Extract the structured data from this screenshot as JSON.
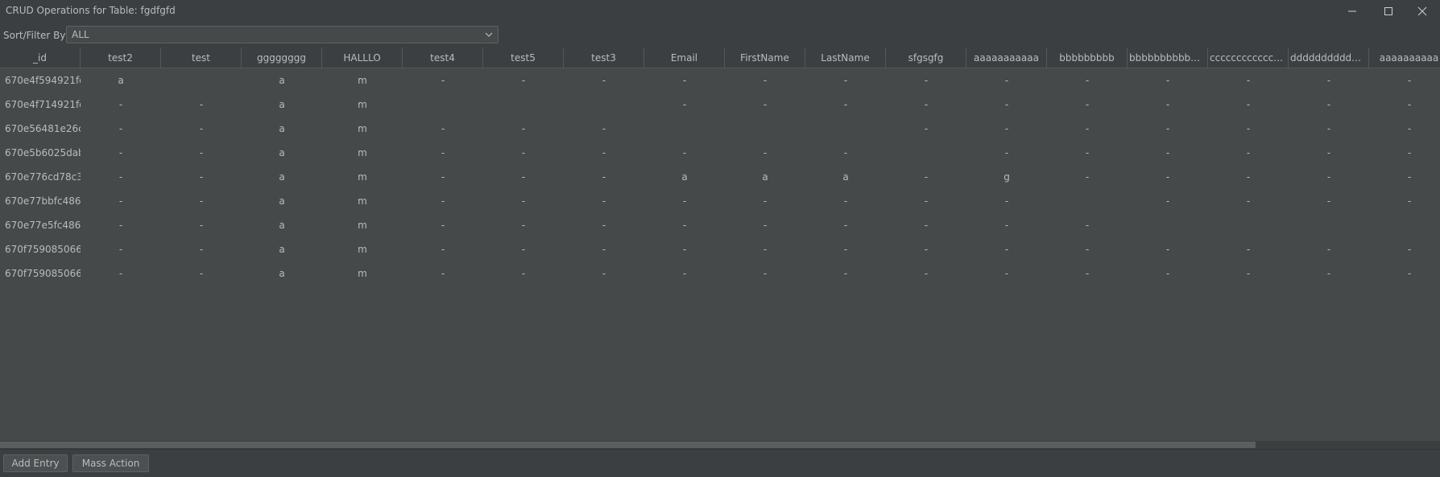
{
  "window": {
    "title": "CRUD Operations for Table: fgdfgfd",
    "icons": [
      "minimize-icon",
      "maximize-icon",
      "close-icon"
    ]
  },
  "filter": {
    "label": "Sort/Filter By:",
    "value": "ALL"
  },
  "table": {
    "columns": [
      "_id",
      "test2",
      "test",
      "gggggggg",
      "HALLLO",
      "test4",
      "test5",
      "test3",
      "Email",
      "FirstName",
      "LastName",
      "sfgsgfg",
      "aaaaaaaaaaa",
      "bbbbbbbbb",
      "bbbbbbbbbbbbb...",
      "cccccccccccccccc",
      "dddddddddddddd",
      "aaaaaaaaaa"
    ],
    "rows": [
      [
        "670e4f594921fe...",
        "a",
        "",
        "a",
        "m",
        "-",
        "-",
        "-",
        "-",
        "-",
        "-",
        "-",
        "-",
        "-",
        "-",
        "-",
        "-",
        "-"
      ],
      [
        "670e4f714921fe...",
        "-",
        "-",
        "a",
        "m",
        "",
        "",
        "",
        "-",
        "-",
        "-",
        "-",
        "-",
        "-",
        "-",
        "-",
        "-",
        "-"
      ],
      [
        "670e56481e26c1...",
        "-",
        "-",
        "a",
        "m",
        "-",
        "-",
        "-",
        "",
        "",
        "",
        "-",
        "-",
        "-",
        "-",
        "-",
        "-",
        "-"
      ],
      [
        "670e5b6025dab...",
        "-",
        "-",
        "a",
        "m",
        "-",
        "-",
        "-",
        "-",
        "-",
        "-",
        "",
        "-",
        "-",
        "-",
        "-",
        "-",
        "-"
      ],
      [
        "670e776cd78c3c...",
        "-",
        "-",
        "a",
        "m",
        "-",
        "-",
        "-",
        "a",
        "a",
        "a",
        "-",
        "g",
        "-",
        "-",
        "-",
        "-",
        "-"
      ],
      [
        "670e77bbfc4867...",
        "-",
        "-",
        "a",
        "m",
        "-",
        "-",
        "-",
        "-",
        "-",
        "-",
        "-",
        "-",
        "",
        "-",
        "-",
        "-",
        "-"
      ],
      [
        "670e77e5fc4867...",
        "-",
        "-",
        "a",
        "m",
        "-",
        "-",
        "-",
        "-",
        "-",
        "-",
        "-",
        "-",
        "-",
        "",
        "",
        "",
        ""
      ],
      [
        "670f759085066e...",
        "-",
        "-",
        "a",
        "m",
        "-",
        "-",
        "-",
        "-",
        "-",
        "-",
        "-",
        "-",
        "-",
        "-",
        "-",
        "-",
        "-"
      ],
      [
        "670f759085066e...",
        "-",
        "-",
        "a",
        "m",
        "-",
        "-",
        "-",
        "-",
        "-",
        "-",
        "-",
        "-",
        "-",
        "-",
        "-",
        "-",
        "-"
      ]
    ]
  },
  "buttons": {
    "add_entry": "Add Entry",
    "mass_action": "Mass Action"
  }
}
